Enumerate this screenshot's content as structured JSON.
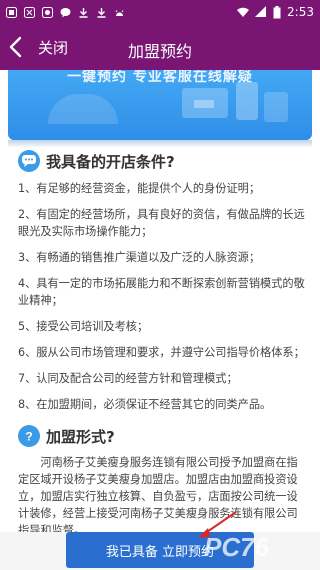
{
  "statusbar": {
    "time": "2:53"
  },
  "header": {
    "close_label": "关闭",
    "title": "加盟预约"
  },
  "banner": {
    "text": "一键预约 专业客服在线解疑"
  },
  "conditions": {
    "title": "我具备的开店条件?",
    "items": [
      "1、有足够的经营资金，能提供个人的身份证明；",
      "2、有固定的经营场所，具有良好的资信，有做品牌的长远眼光及实际市场操作能力；",
      "3、有畅通的销售推广渠道以及广泛的人脉资源；",
      "4、具有一定的市场拓展能力和不断探索创新营销模式的敬业精神；",
      "5、接受公司培训及考核；",
      "6、服从公司市场管理和要求，并遵守公司指导价格体系；",
      "7、认同及配合公司的经营方针和管理模式；",
      "8、在加盟期间，必须保证不经营其它的同类产品。"
    ]
  },
  "form": {
    "title": "加盟形式?",
    "text": "河南杨子艾美瘦身服务连锁有限公司授予加盟商在指定区域开设杨子艾美瘦身加盟店。加盟店由加盟商投资设立，加盟店实行独立核算、自负盈亏，店面按公司统一设计装修，经营上接受河南杨子艾美瘦身服务连锁有限公司指导和监督。"
  },
  "apply_button": {
    "label": "我已具备 立即预约"
  },
  "watermark": {
    "text": "PC76"
  },
  "colors": {
    "header": "#7a1574",
    "banner": "#3a9be8",
    "button": "#2a6fd0",
    "arrow": "#d8282e"
  }
}
